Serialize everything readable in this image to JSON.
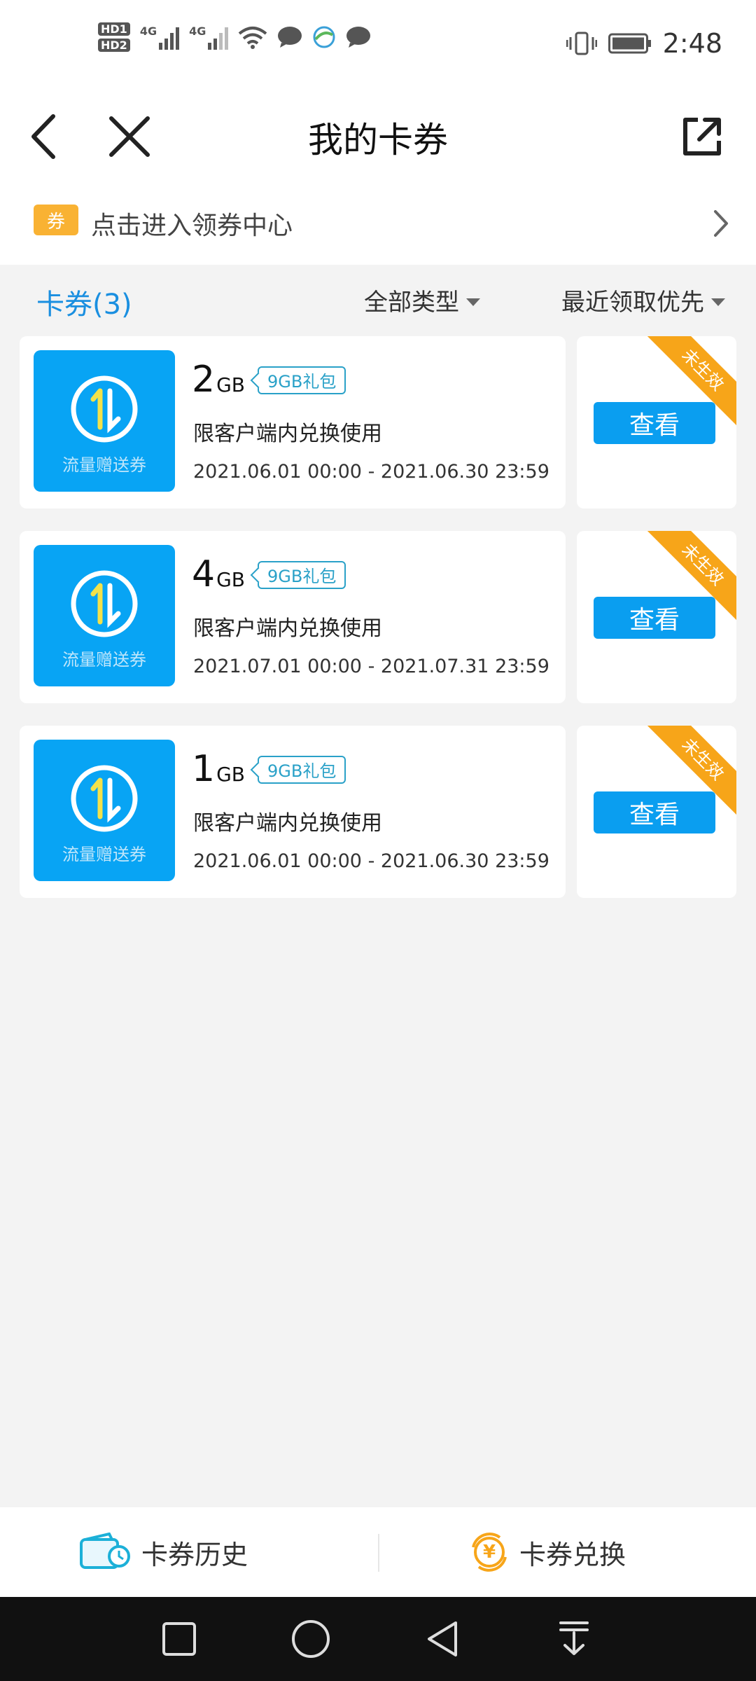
{
  "status_bar": {
    "time": "2:48",
    "net_labels": [
      "HD1",
      "HD2",
      "4G",
      "4G"
    ]
  },
  "header": {
    "title": "我的卡券"
  },
  "coupon_center": {
    "badge": "券",
    "text": "点击进入领券中心"
  },
  "filters": {
    "count_label": "卡券(3)",
    "type_label": "全部类型",
    "sort_label": "最近领取优先"
  },
  "cards": [
    {
      "thumb_label": "流量赠送券",
      "amount": "2",
      "unit": "GB",
      "tag": "9GB礼包",
      "desc": "限客户端内兑换使用",
      "date_range": "2021.06.01 00:00 - 2021.06.30 23:59",
      "button": "查看",
      "ribbon": "未生效"
    },
    {
      "thumb_label": "流量赠送券",
      "amount": "4",
      "unit": "GB",
      "tag": "9GB礼包",
      "desc": "限客户端内兑换使用",
      "date_range": "2021.07.01 00:00 - 2021.07.31 23:59",
      "button": "查看",
      "ribbon": "未生效"
    },
    {
      "thumb_label": "流量赠送券",
      "amount": "1",
      "unit": "GB",
      "tag": "9GB礼包",
      "desc": "限客户端内兑换使用",
      "date_range": "2021.06.01 00:00 - 2021.06.30 23:59",
      "button": "查看",
      "ribbon": "未生效"
    }
  ],
  "bottom_bar": {
    "history_label": "卡券历史",
    "exchange_label": "卡券兑换",
    "currency_symbol": "¥"
  },
  "colors": {
    "accent": "#0a9ef0",
    "ribbon": "#f7a519",
    "count": "#1a8fe0",
    "badge": "#f9b233"
  }
}
